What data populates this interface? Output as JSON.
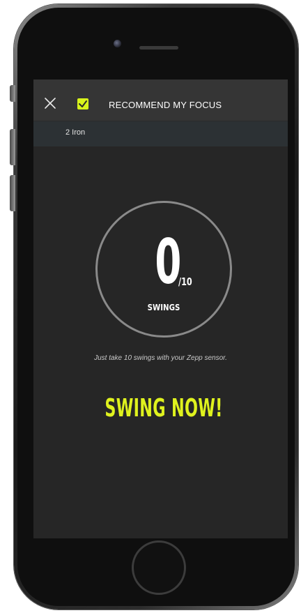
{
  "header": {
    "title": "RECOMMEND MY FOCUS",
    "close_icon": "close-icon",
    "checkbox_icon": "checkbox-icon",
    "checkbox_checked": true,
    "accent_color": "#d8f31b"
  },
  "sub_bar": {
    "club": "2 Iron"
  },
  "counter": {
    "count": "0",
    "target": "/10",
    "label": "SWINGS"
  },
  "instruction": "Just take 10 swings with your Zepp sensor.",
  "cta": {
    "label": "SWING NOW!",
    "color": "#dff21e"
  },
  "colors": {
    "background": "#262626",
    "header": "#353535",
    "sub_bar": "#2c3134"
  }
}
